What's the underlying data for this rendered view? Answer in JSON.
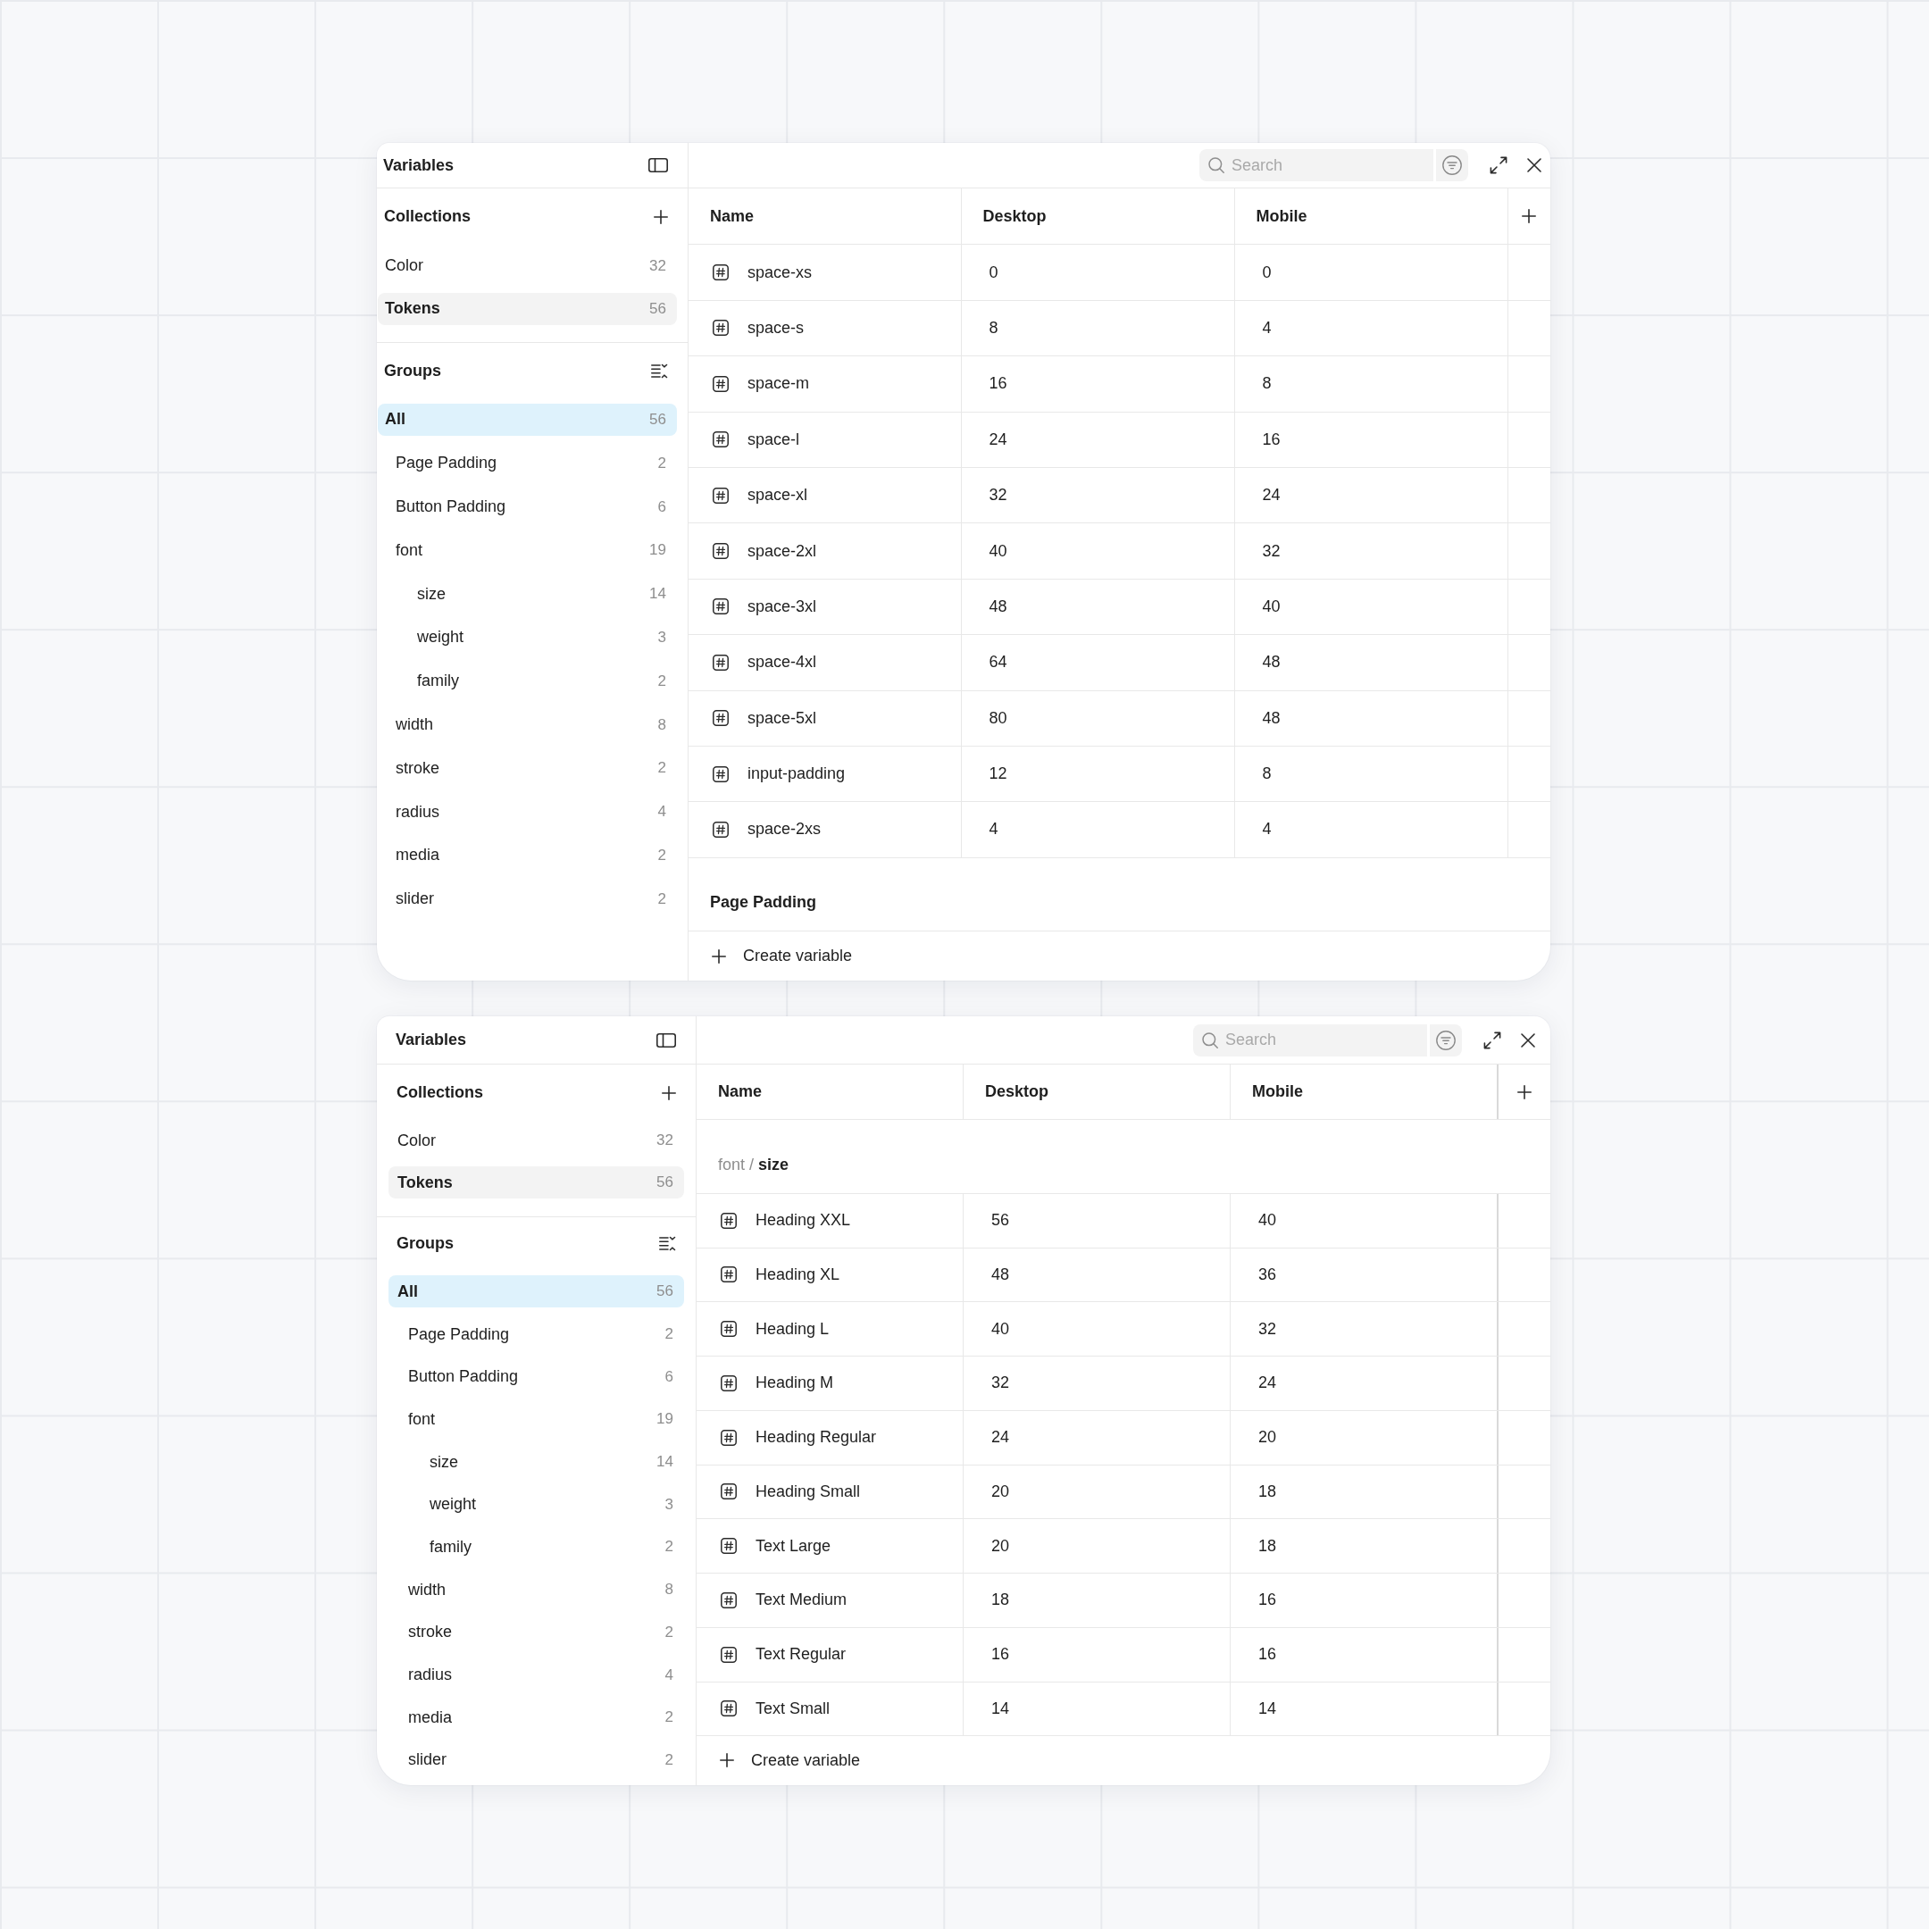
{
  "panels": [
    {
      "title": "Variables",
      "collections": {
        "heading": "Collections",
        "items": [
          {
            "label": "Color",
            "count": "32",
            "selected": false
          },
          {
            "label": "Tokens",
            "count": "56",
            "selected": true
          }
        ]
      },
      "groups": {
        "heading": "Groups",
        "items": [
          {
            "label": "All",
            "count": "56",
            "selected": true,
            "children": [
              {
                "label": "Page Padding",
                "count": "2",
                "selected": false
              },
              {
                "label": "Button Padding",
                "count": "6",
                "selected": false
              },
              {
                "label": "font",
                "count": "19",
                "selected": false,
                "children": [
                  {
                    "label": "size",
                    "count": "14",
                    "selected": false
                  },
                  {
                    "label": "weight",
                    "count": "3",
                    "selected": false
                  },
                  {
                    "label": "family",
                    "count": "2",
                    "selected": false
                  }
                ]
              },
              {
                "label": "width",
                "count": "8",
                "selected": false
              },
              {
                "label": "stroke",
                "count": "2",
                "selected": false
              },
              {
                "label": "radius",
                "count": "4",
                "selected": false
              },
              {
                "label": "media",
                "count": "2",
                "selected": false
              },
              {
                "label": "slider",
                "count": "2",
                "selected": false
              }
            ]
          }
        ]
      },
      "search": {
        "placeholder": "Search"
      },
      "table": {
        "columns": [
          "Name",
          "Desktop",
          "Mobile"
        ],
        "body": [
          {
            "kind": "row",
            "name": "space-xs",
            "values": [
              "0",
              "0"
            ]
          },
          {
            "kind": "row",
            "name": "space-s",
            "values": [
              "8",
              "4"
            ]
          },
          {
            "kind": "row",
            "name": "space-m",
            "values": [
              "16",
              "8"
            ]
          },
          {
            "kind": "row",
            "name": "space-l",
            "values": [
              "24",
              "16"
            ]
          },
          {
            "kind": "row",
            "name": "space-xl",
            "values": [
              "32",
              "24"
            ]
          },
          {
            "kind": "row",
            "name": "space-2xl",
            "values": [
              "40",
              "32"
            ]
          },
          {
            "kind": "row",
            "name": "space-3xl",
            "values": [
              "48",
              "40"
            ]
          },
          {
            "kind": "row",
            "name": "space-4xl",
            "values": [
              "64",
              "48"
            ]
          },
          {
            "kind": "row",
            "name": "space-5xl",
            "values": [
              "80",
              "48"
            ]
          },
          {
            "kind": "row",
            "name": "input-padding",
            "values": [
              "12",
              "8"
            ]
          },
          {
            "kind": "row",
            "name": "space-2xs",
            "values": [
              "4",
              "4"
            ]
          },
          {
            "kind": "group-heading",
            "text": "Page Padding"
          }
        ]
      },
      "create_label": "Create variable"
    },
    {
      "title": "Variables",
      "collections": {
        "heading": "Collections",
        "items": [
          {
            "label": "Color",
            "count": "32",
            "selected": false
          },
          {
            "label": "Tokens",
            "count": "56",
            "selected": true
          }
        ]
      },
      "groups": {
        "heading": "Groups",
        "items": [
          {
            "label": "All",
            "count": "56",
            "selected": true,
            "children": [
              {
                "label": "Page Padding",
                "count": "2",
                "selected": false
              },
              {
                "label": "Button Padding",
                "count": "6",
                "selected": false
              },
              {
                "label": "font",
                "count": "19",
                "selected": false,
                "children": [
                  {
                    "label": "size",
                    "count": "14",
                    "selected": false
                  },
                  {
                    "label": "weight",
                    "count": "3",
                    "selected": false
                  },
                  {
                    "label": "family",
                    "count": "2",
                    "selected": false
                  }
                ]
              },
              {
                "label": "width",
                "count": "8",
                "selected": false
              },
              {
                "label": "stroke",
                "count": "2",
                "selected": false
              },
              {
                "label": "radius",
                "count": "4",
                "selected": false
              },
              {
                "label": "media",
                "count": "2",
                "selected": false
              },
              {
                "label": "slider",
                "count": "2",
                "selected": false
              }
            ]
          }
        ]
      },
      "search": {
        "placeholder": "Search"
      },
      "table": {
        "columns": [
          "Name",
          "Desktop",
          "Mobile"
        ],
        "body": [
          {
            "kind": "breadcrumb",
            "text": "font / **size**"
          },
          {
            "kind": "row",
            "name": "Heading XXL",
            "values": [
              "56",
              "40"
            ]
          },
          {
            "kind": "row",
            "name": "Heading XL",
            "values": [
              "48",
              "36"
            ]
          },
          {
            "kind": "row",
            "name": "Heading L",
            "values": [
              "40",
              "32"
            ]
          },
          {
            "kind": "row",
            "name": "Heading M",
            "values": [
              "32",
              "24"
            ]
          },
          {
            "kind": "row",
            "name": "Heading Regular",
            "values": [
              "24",
              "20"
            ]
          },
          {
            "kind": "row",
            "name": "Heading Small",
            "values": [
              "20",
              "18"
            ]
          },
          {
            "kind": "row",
            "name": "Text Large",
            "values": [
              "20",
              "18"
            ]
          },
          {
            "kind": "row",
            "name": "Text Medium",
            "values": [
              "18",
              "16"
            ]
          },
          {
            "kind": "row",
            "name": "Text Regular",
            "values": [
              "16",
              "16"
            ]
          },
          {
            "kind": "row",
            "name": "Text Small",
            "values": [
              "14",
              "14"
            ]
          }
        ]
      },
      "create_label": "Create variable"
    }
  ]
}
